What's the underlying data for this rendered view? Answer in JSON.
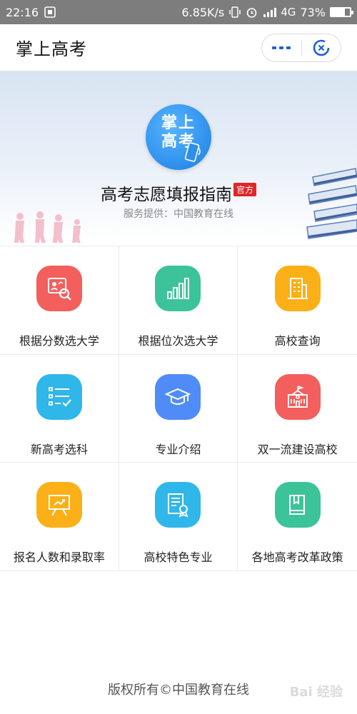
{
  "status_bar": {
    "time": "22:16",
    "network_speed": "6.85K/s",
    "network_type": "4G",
    "battery": "73%",
    "battery_level": 0.73
  },
  "header": {
    "title": "掌上高考"
  },
  "banner": {
    "logo_text_line1": "掌上",
    "logo_text_line2": "高考",
    "title": "高考志愿填报指南",
    "badge": "官方",
    "subtitle": "服务提供：中国教育在线"
  },
  "menu": [
    {
      "label": "根据分数选大学",
      "icon": "score-search-icon",
      "color": "#f25f5c"
    },
    {
      "label": "根据位次选大学",
      "icon": "rank-bars-icon",
      "color": "#3cc39a"
    },
    {
      "label": "高校查询",
      "icon": "building-icon",
      "color": "#fbb018"
    },
    {
      "label": "新高考选科",
      "icon": "checklist-icon",
      "color": "#2fb7ea"
    },
    {
      "label": "专业介绍",
      "icon": "graduation-cap-icon",
      "color": "#4f8cf7"
    },
    {
      "label": "双一流建设高校",
      "icon": "school-icon",
      "color": "#f25f5c"
    },
    {
      "label": "报名人数和录取率",
      "icon": "presentation-board-icon",
      "color": "#fbb018"
    },
    {
      "label": "高校特色专业",
      "icon": "certificate-icon",
      "color": "#2fb7ea"
    },
    {
      "label": "各地高考改革政策",
      "icon": "book-icon",
      "color": "#3cc39a"
    }
  ],
  "footer": {
    "copyright": "版权所有©中国教育在线"
  },
  "watermark": "Bai 经验"
}
